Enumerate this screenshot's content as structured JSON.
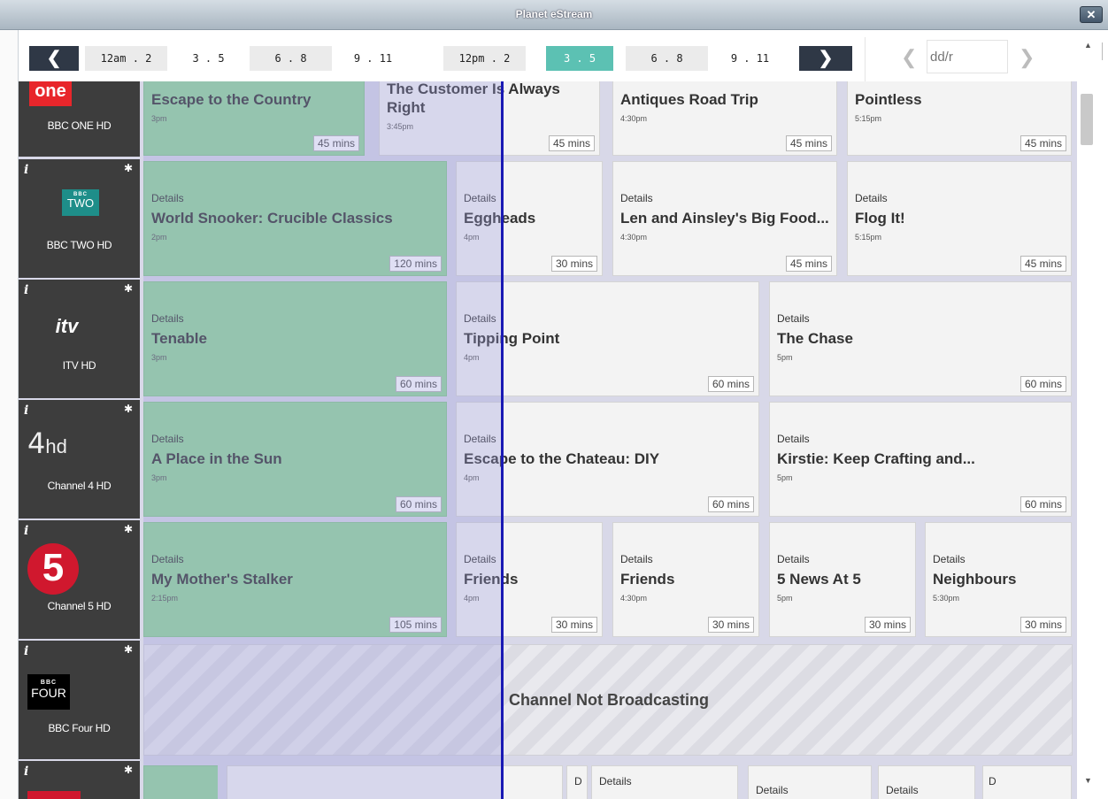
{
  "window": {
    "title": "Planet eStream",
    "close_label": "✕"
  },
  "timenav": {
    "prev_label": "❮",
    "next_label": "❯",
    "slots": [
      {
        "label": "12am . 2",
        "state": "odd"
      },
      {
        "label": "3 . 5",
        "state": "even"
      },
      {
        "label": "6 . 8",
        "state": "odd"
      },
      {
        "label": "9 . 11",
        "state": "even"
      },
      {
        "label": "12pm . 2",
        "state": "odd"
      },
      {
        "label": "3 . 5",
        "state": "active"
      },
      {
        "label": "6 . 8",
        "state": "odd"
      },
      {
        "label": "9 . 11",
        "state": "even"
      }
    ],
    "date_placeholder": "dd/r",
    "date_prev": "❮",
    "date_next": "❯"
  },
  "channels": [
    {
      "name": "BBC ONE HD",
      "logo": "bbc-one"
    },
    {
      "name": "BBC TWO HD",
      "logo": "bbc-two"
    },
    {
      "name": "ITV HD",
      "logo": "itv"
    },
    {
      "name": "Channel 4 HD",
      "logo": "channel-4"
    },
    {
      "name": "Channel 5 HD",
      "logo": "channel-5"
    },
    {
      "name": "BBC Four HD",
      "logo": "bbc-four"
    }
  ],
  "channel_info_glyph": "i",
  "channel_pin_glyph": "✱",
  "logos": {
    "bbc_one_text": "one",
    "bbc_two_text": "TWO",
    "bbc_mark": "BBC",
    "bbc_four_text": "FOUR",
    "itv_text": "itv",
    "ch4_text": "4",
    "ch4_hd": "hd",
    "ch5_text": "5"
  },
  "details_label": "Details",
  "programmes": {
    "bbc_one": [
      {
        "title": "Escape to the Country",
        "time": "3pm",
        "duration": "45 mins"
      },
      {
        "title": "The Customer Is Always",
        "title2": "Right",
        "time": "3:45pm",
        "duration": "45 mins"
      },
      {
        "title": "Antiques Road Trip",
        "time": "4:30pm",
        "duration": "45 mins"
      },
      {
        "title": "Pointless",
        "time": "5:15pm",
        "duration": "45 mins"
      }
    ],
    "bbc_two": [
      {
        "title": "World Snooker: Crucible Classics",
        "time": "2pm",
        "duration": "120 mins"
      },
      {
        "title": "Eggheads",
        "time": "4pm",
        "duration": "30 mins"
      },
      {
        "title": "Len and Ainsley's Big Food...",
        "time": "4:30pm",
        "duration": "45 mins"
      },
      {
        "title": "Flog It!",
        "time": "5:15pm",
        "duration": "45 mins"
      }
    ],
    "itv": [
      {
        "title": "Tenable",
        "time": "3pm",
        "duration": "60 mins"
      },
      {
        "title": "Tipping Point",
        "time": "4pm",
        "duration": "60 mins"
      },
      {
        "title": "The Chase",
        "time": "5pm",
        "duration": "60 mins"
      }
    ],
    "ch4": [
      {
        "title": "A Place in the Sun",
        "time": "3pm",
        "duration": "60 mins"
      },
      {
        "title": "Escape to the Chateau: DIY",
        "time": "4pm",
        "duration": "60 mins"
      },
      {
        "title": "Kirstie: Keep Crafting and...",
        "time": "5pm",
        "duration": "60 mins"
      }
    ],
    "ch5": [
      {
        "title": "My Mother's Stalker",
        "time": "2:15pm",
        "duration": "105 mins"
      },
      {
        "title": "Friends",
        "time": "4pm",
        "duration": "30 mins"
      },
      {
        "title": "Friends",
        "time": "4:30pm",
        "duration": "30 mins"
      },
      {
        "title": "5 News At 5",
        "time": "5pm",
        "duration": "30 mins"
      },
      {
        "title": "Neighbours",
        "time": "5:30pm",
        "duration": "30 mins"
      }
    ]
  },
  "not_broadcasting": "Channel Not Broadcasting",
  "partial_row": {
    "labels": [
      "D",
      "Details",
      "Details",
      "Details",
      "D"
    ]
  },
  "scroll": {
    "up": "▲",
    "down": "▼"
  },
  "colors": {
    "now": "#93d89a",
    "active_slot": "#5cc1b3",
    "nav_dark": "#2f3846",
    "channel_bg": "#3d3d3d",
    "now_line": "#1919b4"
  }
}
